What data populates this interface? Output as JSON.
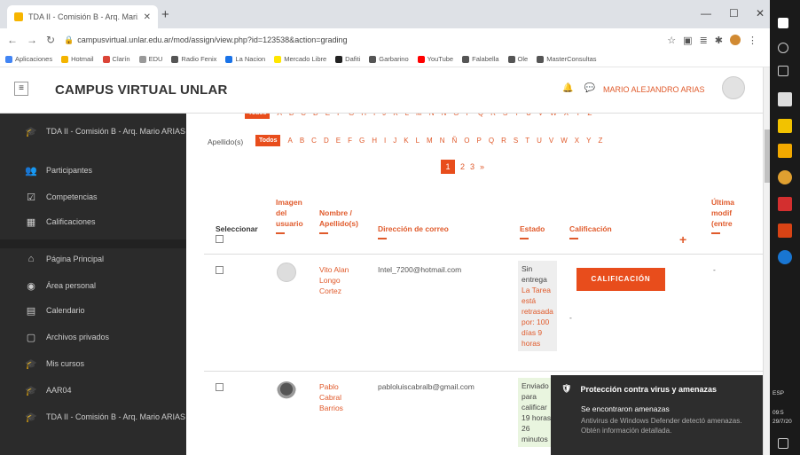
{
  "browser": {
    "tab_title": "TDA II - Comisión B - Arq. Mari...",
    "url": "campusvirtual.unlar.edu.ar/mod/assign/view.php?id=123538&action=grading",
    "bookmarks": [
      {
        "label": "Aplicaciones",
        "color": "#4285f4"
      },
      {
        "label": "Hotmail",
        "color": "#f4b400"
      },
      {
        "label": "Clarín",
        "color": "#db4437"
      },
      {
        "label": "EDU",
        "color": "#999999"
      },
      {
        "label": "Radio Fenix",
        "color": "#555555"
      },
      {
        "label": "La Nacion",
        "color": "#1a73e8"
      },
      {
        "label": "Mercado Libre",
        "color": "#ffe600"
      },
      {
        "label": "Dafiti",
        "color": "#222222"
      },
      {
        "label": "Garbarino",
        "color": "#555555"
      },
      {
        "label": "YouTube",
        "color": "#ff0000"
      },
      {
        "label": "Falabella",
        "color": "#555555"
      },
      {
        "label": "Ole",
        "color": "#555555"
      },
      {
        "label": "MasterConsultas",
        "color": "#555555"
      }
    ]
  },
  "header": {
    "site_title": "CAMPUS VIRTUAL UNLAR",
    "user_name": "MARIO ALEJANDRO ARIAS"
  },
  "sidebar": {
    "items": [
      {
        "label": "TDA II - Comisión B - Arq. Mario ARIAS",
        "icon": "graduation-cap-icon",
        "glyph": "🎓"
      },
      {
        "label": "Participantes",
        "icon": "users-icon",
        "glyph": "👥"
      },
      {
        "label": "Competencias",
        "icon": "checkbox-icon",
        "glyph": "☑"
      },
      {
        "label": "Calificaciones",
        "icon": "table-icon",
        "glyph": "▦"
      },
      {
        "label": "Página Principal",
        "icon": "home-icon",
        "glyph": "⌂"
      },
      {
        "label": "Área personal",
        "icon": "dashboard-icon",
        "glyph": "◉"
      },
      {
        "label": "Calendario",
        "icon": "calendar-icon",
        "glyph": "▤"
      },
      {
        "label": "Archivos privados",
        "icon": "file-icon",
        "glyph": "▢"
      },
      {
        "label": "Mis cursos",
        "icon": "graduation-cap-icon",
        "glyph": "🎓"
      },
      {
        "label": "AAR04",
        "icon": "graduation-cap-icon",
        "glyph": "🎓"
      },
      {
        "label": "TDA II - Comisión B - Arq. Mario ARIAS",
        "icon": "graduation-cap-icon",
        "glyph": "🎓"
      }
    ]
  },
  "filter": {
    "label": "Apellido(s)",
    "all_label": "Todos",
    "letters": [
      "A",
      "B",
      "C",
      "D",
      "E",
      "F",
      "G",
      "H",
      "I",
      "J",
      "K",
      "L",
      "M",
      "N",
      "Ñ",
      "O",
      "P",
      "Q",
      "R",
      "S",
      "T",
      "U",
      "V",
      "W",
      "X",
      "Y",
      "Z"
    ]
  },
  "pagination": {
    "current": "1",
    "pages": [
      "2",
      "3"
    ],
    "next": "»"
  },
  "table": {
    "headers": {
      "select": "Seleccionar",
      "image": "Imagen del usuario",
      "name": "Nombre / Apellido(s)",
      "email": "Dirección de correo",
      "status": "Estado",
      "grade": "Calificación",
      "last_modified": "Última modif (entre"
    },
    "rows": [
      {
        "name": "Vito Alan Longo Cortez",
        "email": "Intel_7200@hotmail.com",
        "status": "Sin entrega",
        "late": "La Tarea está retrasada por: 100 días 9 horas",
        "grade_button": "CALIFICACIÓN",
        "grade_value": "-",
        "last_modified": "-"
      },
      {
        "name": "Pablo Cabral Barrios",
        "email": "pabloluiscabralb@gmail.com",
        "status": "Enviado para calificar 19 horas 26 minutos",
        "late": ""
      }
    ]
  },
  "toast": {
    "title": "Protección contra virus y amenazas",
    "heading": "Se encontraron amenazas",
    "body": "Antivirus de Windows Defender detectó amenazas. Obtén información detallada."
  },
  "taskbar": {
    "lang": "ESP",
    "time": "09:5",
    "date": "29/7/20"
  }
}
